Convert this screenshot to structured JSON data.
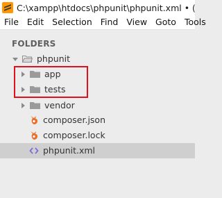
{
  "window": {
    "title": "C:\\xampp\\htdocs\\phpunit\\phpunit.xml • (phpunit) - Sublime Text"
  },
  "menu": [
    "File",
    "Edit",
    "Selection",
    "Find",
    "View",
    "Goto",
    "Tools"
  ],
  "sidebar": {
    "heading": "FOLDERS",
    "root": {
      "label": "phpunit",
      "icon": "folder-open-icon"
    },
    "items": [
      {
        "label": "app",
        "icon": "folder-icon",
        "expandable": true
      },
      {
        "label": "tests",
        "icon": "folder-icon",
        "expandable": true
      },
      {
        "label": "vendor",
        "icon": "folder-icon",
        "expandable": true
      },
      {
        "label": "composer.json",
        "icon": "composer-file-icon"
      },
      {
        "label": "composer.lock",
        "icon": "composer-file-icon"
      },
      {
        "label": "phpunit.xml",
        "icon": "xml-code-icon",
        "selected": true
      }
    ]
  },
  "colors": {
    "highlight": "#e0101c",
    "composer_icon": "#e8702a",
    "xml_icon": "#7a6fd6",
    "folder": "#9a9a9a"
  }
}
